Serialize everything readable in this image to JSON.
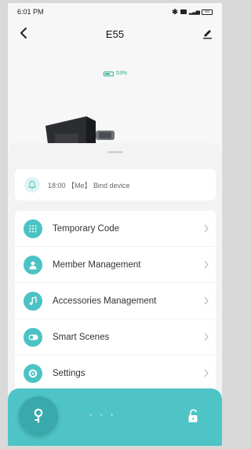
{
  "status_bar": {
    "time": "6:01 PM",
    "icons": [
      "bluetooth-icon",
      "message-icon",
      "signal-icon",
      "battery-icon"
    ],
    "battery_text": "69"
  },
  "header": {
    "title": "E55",
    "back_icon": "chevron-left-icon",
    "edit_icon": "pencil-icon"
  },
  "device": {
    "battery_percent_text": "53%",
    "battery_level": 0.53
  },
  "notice": {
    "icon": "bell-icon",
    "text": "18:00 【Me】 Bind device"
  },
  "menu": {
    "items": [
      {
        "label": "Temporary Code",
        "icon": "keypad-icon"
      },
      {
        "label": "Member Management",
        "icon": "person-icon"
      },
      {
        "label": "Accessories Management",
        "icon": "music-note-icon"
      },
      {
        "label": "Smart Scenes",
        "icon": "toggle-icon"
      },
      {
        "label": "Settings",
        "icon": "gear-icon"
      }
    ]
  },
  "bottom_bar": {
    "key_icon": "key-icon",
    "slide_arrows": "› › ›",
    "unlock_icon": "unlock-icon"
  },
  "colors": {
    "accent": "#4bc3c4",
    "bottom_bar": "#4fc4c6",
    "battery_green": "#27ae8f"
  }
}
